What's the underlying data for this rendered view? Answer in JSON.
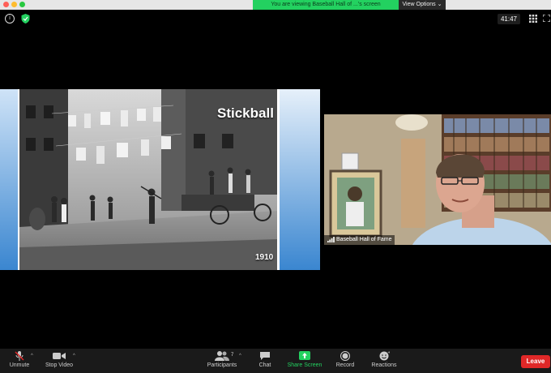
{
  "banner": {
    "text": "You are viewing Baseball Hall of ...'s screen",
    "view_options": "View Options"
  },
  "meeting": {
    "timer": "41:47"
  },
  "slide": {
    "title": "Stickball",
    "year": "1910"
  },
  "speaker": {
    "name": "Baseball Hall of Fame"
  },
  "toolbar": {
    "unmute": "Unmute",
    "stop_video": "Stop Video",
    "participants": "Participants",
    "participants_count": "7",
    "chat": "Chat",
    "share_screen": "Share Screen",
    "record": "Record",
    "reactions": "Reactions",
    "leave": "Leave"
  },
  "colors": {
    "share_green": "#23d160",
    "leave_red": "#e02828",
    "banner_green": "#23d160"
  },
  "icons": [
    "info-icon",
    "shield-icon",
    "grid-icon",
    "fullscreen-icon",
    "mic-muted-icon",
    "video-camera-icon",
    "participants-icon",
    "chat-icon",
    "share-screen-icon",
    "record-icon",
    "reactions-icon",
    "signal-icon"
  ]
}
